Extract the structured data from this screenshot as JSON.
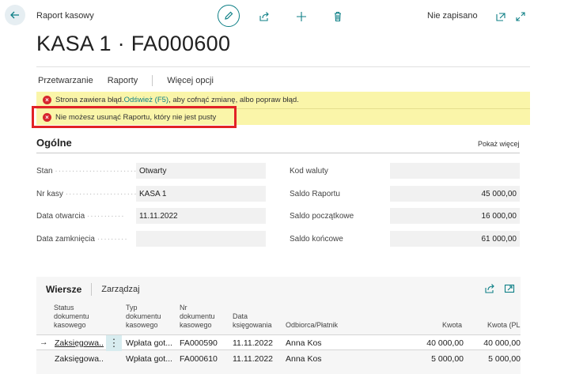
{
  "header": {
    "page_kicker": "Raport kasowy",
    "title": "KASA 1 · FA000600",
    "save_status": "Nie zapisano"
  },
  "actions": {
    "items": [
      "Przetwarzanie",
      "Raporty",
      "Więcej opcji"
    ]
  },
  "errors": {
    "banner1_before": "Strona zawiera błąd. ",
    "banner1_link": "Odśwież (F5)",
    "banner1_after": ", aby cofnąć zmianę, albo popraw błąd.",
    "banner2": "Nie możesz usunąć Raportu, który nie jest pusty"
  },
  "general": {
    "title": "Ogólne",
    "show_more": "Pokaż więcej",
    "left_fields": [
      {
        "label": "Stan",
        "value": "Otwarty"
      },
      {
        "label": "Nr kasy",
        "value": "KASA 1"
      },
      {
        "label": "Data otwarcia",
        "value": "11.11.2022"
      },
      {
        "label": "Data zamknięcia",
        "value": ""
      }
    ],
    "right_fields": [
      {
        "label": "Kod waluty",
        "value": ""
      },
      {
        "label": "Saldo Raportu",
        "value": "45 000,00"
      },
      {
        "label": "Saldo początkowe",
        "value": "16 000,00"
      },
      {
        "label": "Saldo końcowe",
        "value": "61 000,00"
      }
    ]
  },
  "lines": {
    "tab_lines": "Wiersze",
    "tab_manage": "Zarządzaj",
    "columns": [
      [
        "Status",
        "dokumentu",
        "kasowego"
      ],
      [
        "Typ",
        "dokumentu",
        "kasowego"
      ],
      [
        "Nr",
        "dokumentu",
        "kasowego"
      ],
      [
        "Data",
        "księgowania"
      ],
      [
        "Odbiorca/Płatnik"
      ],
      [
        "Kwota"
      ],
      [
        "Kwota (PLN)"
      ]
    ],
    "rows": [
      {
        "status": "Zaksięgowa...",
        "type": "Wpłata got...",
        "no": "FA000590",
        "date": "11.11.2022",
        "payer": "Anna Kos",
        "amount": "40 000,00",
        "amount_pln": "40 000,00"
      },
      {
        "status": "Zaksięgowa...",
        "type": "Wpłata got...",
        "no": "FA000610",
        "date": "11.11.2022",
        "payer": "Anna Kos",
        "amount": "5 000,00",
        "amount_pln": "5 000,00"
      }
    ]
  },
  "colors": {
    "accent": "#0d7f86",
    "error": "#d6262d",
    "banner": "#faf5a9",
    "highlight_border": "#e22226"
  }
}
